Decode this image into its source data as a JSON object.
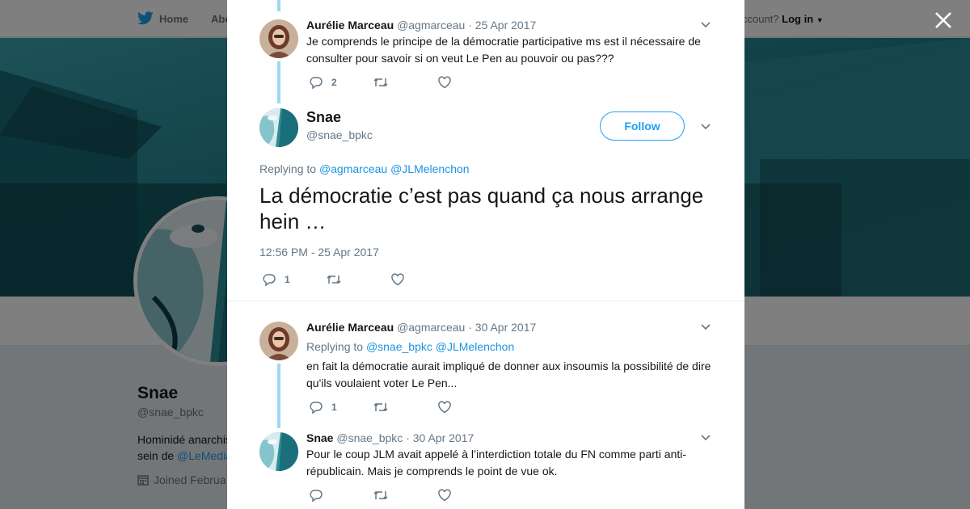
{
  "background": {
    "nav": {
      "home": "Home",
      "about": "Abo",
      "account_prompt": "ccount?",
      "login": "Log in"
    },
    "profile": {
      "name": "Snae",
      "handle": "@snae_bpkc",
      "bio_line1": "Hominidé anarchis",
      "bio_line2_prefix": "sein de ",
      "bio_link": "@LeMedia",
      "joined": "Joined Februa"
    }
  },
  "tweets": [
    {
      "name": "Aurélie Marceau",
      "handle": "@agmarceau",
      "date": "25 Apr 2017",
      "text": "Je comprends le principe de la démocratie participative ms est il nécessaire de consulter pour savoir si on veut Le Pen au pouvoir ou pas???",
      "reply_count": "2"
    },
    {
      "name": "Snae",
      "handle": "@snae_bpkc",
      "follow_label": "Follow",
      "replying_label": "Replying to",
      "replying_to": [
        "@agmarceau",
        "@JLMelenchon"
      ],
      "text": "La démocratie c’est pas quand ça nous arrange hein …",
      "timestamp": "12:56 PM - 25 Apr 2017",
      "reply_count": "1"
    },
    {
      "name": "Aurélie Marceau",
      "handle": "@agmarceau",
      "date": "30 Apr 2017",
      "replying_label": "Replying to",
      "replying_to": [
        "@snae_bpkc",
        "@JLMelenchon"
      ],
      "text": "en fait la démocratie aurait impliqué de donner aux insoumis la possibilité de dire qu'ils voulaient voter Le Pen...",
      "reply_count": "1"
    },
    {
      "name": "Snae",
      "handle": "@snae_bpkc",
      "date": "30 Apr 2017",
      "text": "Pour le coup JLM avait appelé à l’interdiction totale du FN comme parti anti-républicain. Mais je comprends le point de vue ok.",
      "reply_count": ""
    }
  ],
  "colors": {
    "accent": "#1da1f2",
    "link": "#1b95e0",
    "muted": "#657786",
    "thread_line": "#9fd8ef"
  },
  "icons": [
    "twitter-bird-icon",
    "close-icon",
    "chevron-down-icon",
    "reply-icon",
    "retweet-icon",
    "like-icon",
    "calendar-icon"
  ]
}
